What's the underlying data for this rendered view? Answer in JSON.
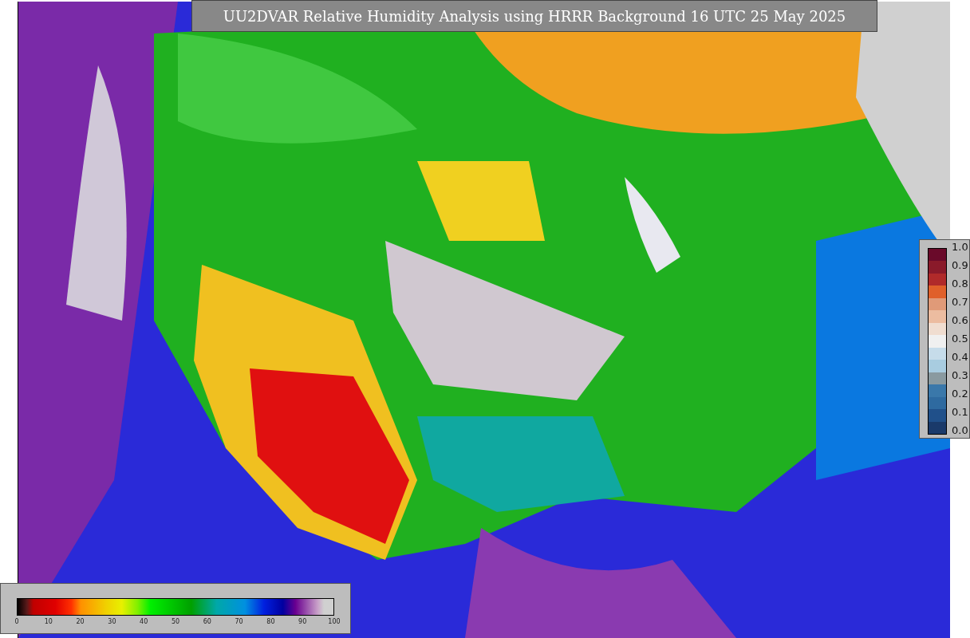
{
  "title": "UU2DVAR Relative Humidity Analysis using HRRR Background 16 UTC 25 May 2025",
  "humidity_colorbar": {
    "ticks": [
      "0",
      "10",
      "20",
      "30",
      "40",
      "50",
      "60",
      "70",
      "80",
      "90",
      "100"
    ]
  },
  "observation_colorbar": {
    "ticks": [
      "1.0",
      "0.9",
      "0.8",
      "0.7",
      "0.6",
      "0.5",
      "0.4",
      "0.3",
      "0.2",
      "0.1",
      "0.0"
    ]
  }
}
